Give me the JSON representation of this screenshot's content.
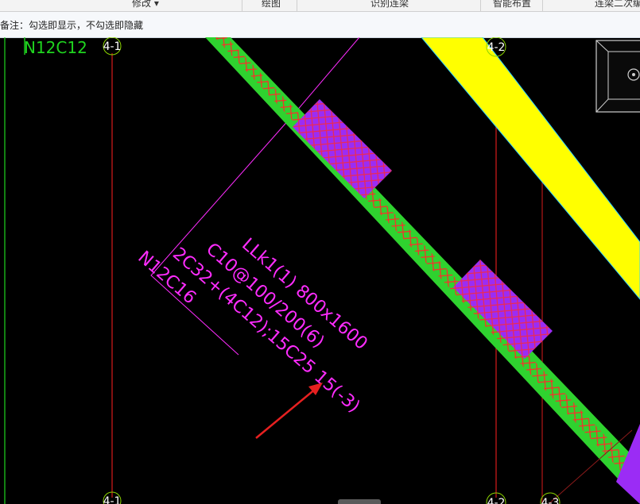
{
  "ribbon": {
    "tabs": [
      {
        "label": "修改 ▾",
        "key": "modify"
      },
      {
        "label": "绘图",
        "key": "draw"
      },
      {
        "label": "识别连梁",
        "key": "identify"
      },
      {
        "label": "智能布置",
        "key": "smart"
      },
      {
        "label": "连梁二次编",
        "key": "second"
      }
    ]
  },
  "hint": {
    "text": "备注：勾选即显示，不勾选即隐藏"
  },
  "cad": {
    "axis_labels": {
      "a_top": "4-1",
      "b_top": "4-2",
      "a_bottom": "4-1",
      "b_bottom": "4-2",
      "c_bottom": "4-3"
    },
    "top_label": "N12C12",
    "beam_annotation": {
      "line1": "LLk1(1) 800x1600",
      "line2": "C10@100/200(6)",
      "line3": "2C32+(4C12);15C25 15(-3)",
      "line4": "N12C16"
    },
    "colors": {
      "beam_green": "#2fd22f",
      "hatch_red": "#ff2a2a",
      "slab_yellow": "#ffff00",
      "column_purple": "#9b2cf5",
      "text_magenta": "#ff2cff",
      "axis_red": "#d81b1b",
      "label_green": "#1fd41f",
      "arrow_red": "#e62020"
    }
  }
}
